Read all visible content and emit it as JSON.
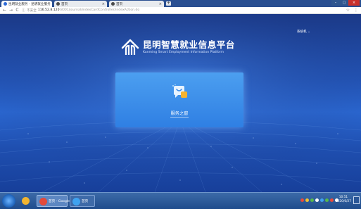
{
  "browser": {
    "tabs": [
      {
        "title": "昆明就业服务 - 昆明就业服务",
        "close": "×"
      },
      {
        "title": "首页",
        "close": "×"
      },
      {
        "title": "首页",
        "close": "×"
      }
    ],
    "new_tab": "+",
    "window_controls": [
      "–",
      "▢",
      "×"
    ],
    "nav": {
      "back": "←",
      "forward": "→",
      "reload": "C"
    },
    "address": {
      "lock": "ⓘ",
      "insecure_label": "不安全",
      "host": "116.52.8.120",
      "path": ":8001/journal/indexCardController/indexAction.do"
    },
    "toolbar_right": [
      "☆",
      "⋮"
    ]
  },
  "page": {
    "account_label": "系统机 ⌄",
    "logo_title": "昆明智慧就业信息平台",
    "logo_subtitle": "Kunming Smart Employment Information Platform",
    "service_label": "服务之窗"
  },
  "taskbar": {
    "apps": [
      {
        "label": "",
        "color": "#f1b531"
      },
      {
        "label": "首页 - Google C...",
        "color": "#e24a3b"
      },
      {
        "label": "首页",
        "color": "#3fa2ef"
      }
    ],
    "clock_time": "10:51",
    "clock_date": "2020/6/27"
  },
  "colors": {
    "page_bg": "#2354b5",
    "card": "#3f8fea",
    "taskbar": "#2a5a9e"
  }
}
